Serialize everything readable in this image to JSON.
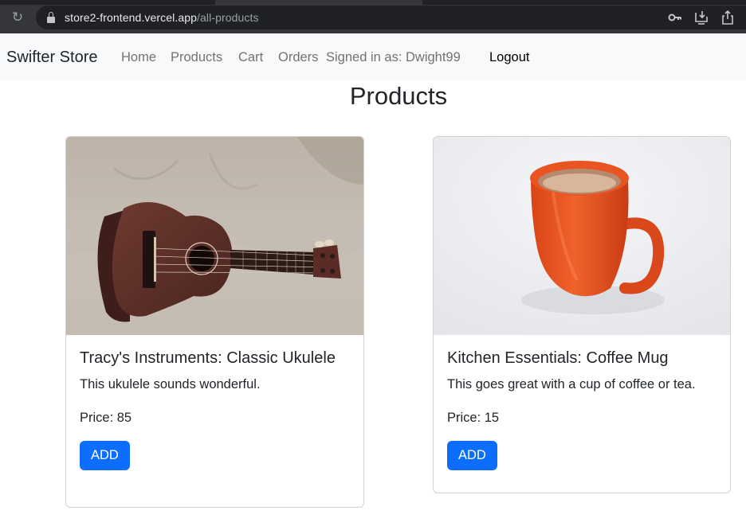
{
  "browser": {
    "url_host": "store2-frontend.vercel.app",
    "url_path": "/all-products",
    "icons": [
      "reload-icon",
      "lock-icon",
      "key-icon",
      "install-app-icon",
      "share-icon"
    ]
  },
  "navbar": {
    "brand": "Swifter Store",
    "links": [
      {
        "label": "Home"
      },
      {
        "label": "Products"
      },
      {
        "label": "Cart"
      },
      {
        "label": "Orders"
      }
    ],
    "signed_in_text": "Signed in as: Dwight99",
    "logout_label": "Logout"
  },
  "page": {
    "title": "Products"
  },
  "products": [
    {
      "title": "Tracy's Instruments: Classic Ukulele",
      "description": "This ukulele sounds wonderful.",
      "price_text": "Price: 85",
      "price": 85,
      "button_label": "ADD",
      "image_alt": "Wooden ukulele lying on a beige couch"
    },
    {
      "title": "Kitchen Essentials: Coffee Mug",
      "description": "This goes great with a cup of coffee or tea.",
      "price_text": "Price: 15",
      "price": 15,
      "button_label": "ADD",
      "image_alt": "Orange coffee mug on white background"
    }
  ],
  "colors": {
    "primary": "#0d6efd",
    "navbar_bg": "#f8f9fa",
    "chrome_bg": "#35363a"
  }
}
